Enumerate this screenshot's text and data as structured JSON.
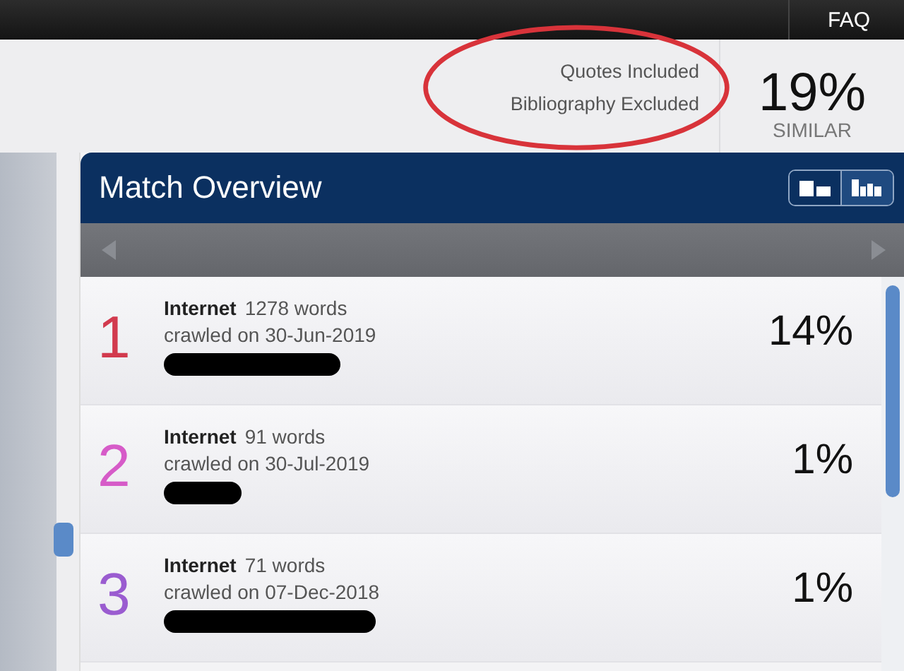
{
  "top_bar": {
    "links": [
      "FAQ"
    ]
  },
  "report": {
    "filters": [
      "Quotes Included",
      "Bibliography Excluded"
    ],
    "score": "19%",
    "score_label": "SIMILAR"
  },
  "panel": {
    "title": "Match Overview",
    "view_toggle": [
      {
        "kind": "blocks",
        "selected": false
      },
      {
        "kind": "bars",
        "selected": true
      }
    ]
  },
  "matches": [
    {
      "number": "1",
      "color": "#d23a4e",
      "source": "Internet",
      "words": "1278 words",
      "date": "crawled on 30-Jun-2019",
      "percent": "14%",
      "redacted": true
    },
    {
      "number": "2",
      "color": "#d65bc8",
      "source": "Internet",
      "words": "91 words",
      "date": "crawled on 30-Jul-2019",
      "percent": "1%",
      "redacted": true
    },
    {
      "number": "3",
      "color": "#9a5cd0",
      "source": "Internet",
      "words": "71 words",
      "date": "crawled on 07-Dec-2018",
      "percent": "1%",
      "redacted": true
    }
  ]
}
